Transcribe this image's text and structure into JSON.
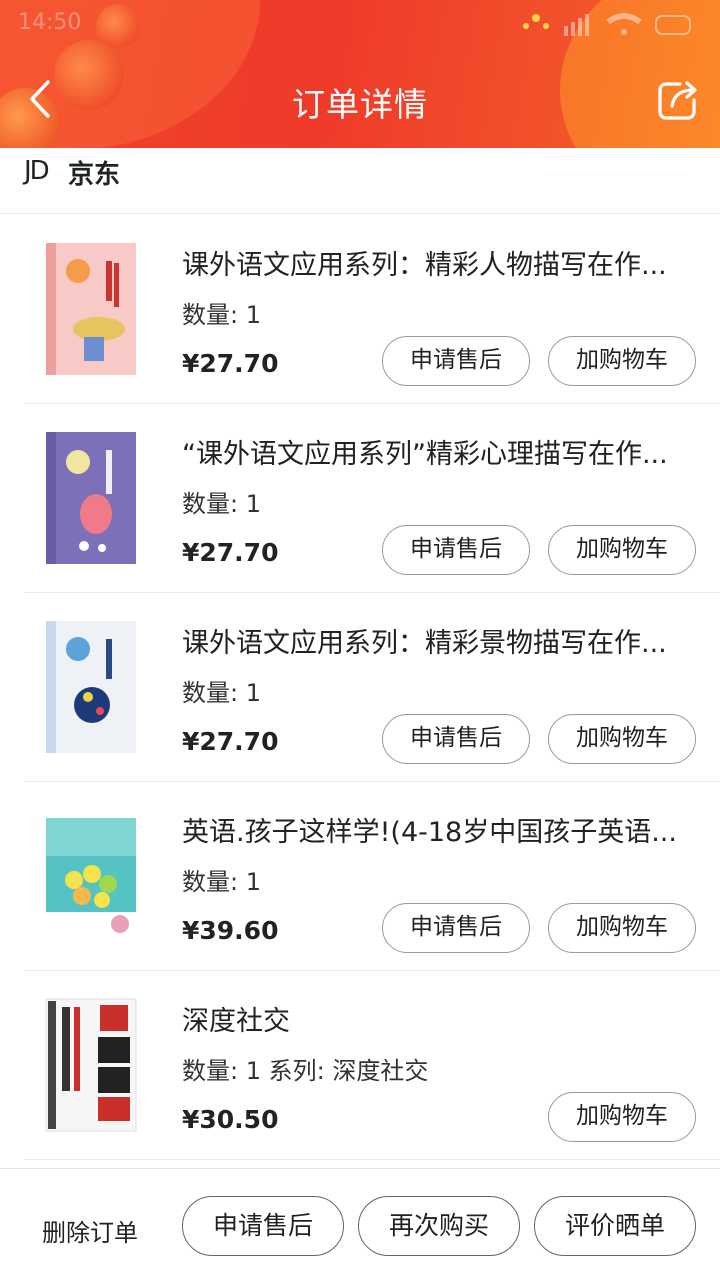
{
  "header": {
    "status_time": "14:50",
    "title": "订单详情",
    "colors": {
      "header_red": "#ef3a2a",
      "header_orange": "#f7782a"
    }
  },
  "store": {
    "logo": "JD",
    "name": "京东"
  },
  "products": [
    {
      "title": "课外语文应用系列：精彩人物描写在作...",
      "qty": "数量: 1",
      "price": "¥27.70",
      "after_sales": "申请售后",
      "add_cart": "加购物车",
      "cover": "pink"
    },
    {
      "title": "“课外语文应用系列”精彩心理描写在作...",
      "qty": "数量: 1",
      "price": "¥27.70",
      "after_sales": "申请售后",
      "add_cart": "加购物车",
      "cover": "purple"
    },
    {
      "title": "课外语文应用系列：精彩景物描写在作...",
      "qty": "数量: 1",
      "price": "¥27.70",
      "after_sales": "申请售后",
      "add_cart": "加购物车",
      "cover": "white-blue"
    },
    {
      "title": "英语.孩子这样学!(4-18岁中国孩子英语...",
      "qty": "数量: 1",
      "price": "¥39.60",
      "after_sales": "申请售后",
      "add_cart": "加购物车",
      "cover": "teal"
    },
    {
      "title": "深度社交",
      "qty": "数量: 1 系列: 深度社交",
      "price": "¥30.50",
      "add_cart": "加购物车",
      "cover": "white-red"
    }
  ],
  "bottom_bar": {
    "delete_order": "删除订单",
    "apply_after_sales": "申请售后",
    "buy_again": "再次购买",
    "review": "评价晒单"
  }
}
